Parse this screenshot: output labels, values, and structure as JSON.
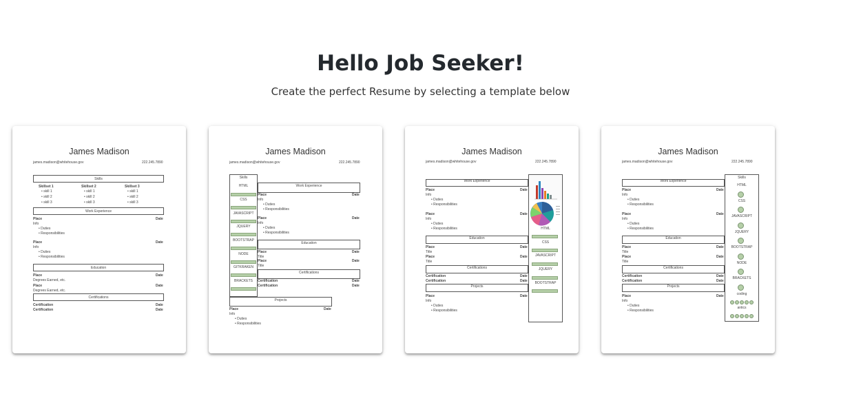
{
  "header": {
    "title": "Hello Job Seeker!",
    "subtitle": "Create the perfect Resume by selecting a template below"
  },
  "resume": {
    "name": "James Madison",
    "email": "james.madison@whitehouse.gov",
    "phone": "222.245.7890",
    "skills": "Skills",
    "skillset1": "Skillset 1",
    "skillset2": "Skillset 2",
    "skillset3": "Skillset 3",
    "skill1": "skill 1",
    "skill2": "skill 2",
    "skill3": "skill 3",
    "work": "Work Experience",
    "place": "Place",
    "date": "Date",
    "info": "Info",
    "duties": "Duties",
    "responsibilities": "Responsibilities",
    "education": "Education",
    "degrees": "Degrees Earned, etc.",
    "title": "Title",
    "certifications": "Certifications",
    "certification": "Certification",
    "projects": "Projects",
    "html": "HTML",
    "css": "CSS",
    "javascript": "JAVASCRIPT",
    "jquery": "JQUERY",
    "bootstrap": "BOOTSTRAP",
    "node": "NODE",
    "gitkraken": "GITKRAKEN",
    "brackets": "BRACKETS",
    "coding": "coding",
    "antics": "antics"
  }
}
